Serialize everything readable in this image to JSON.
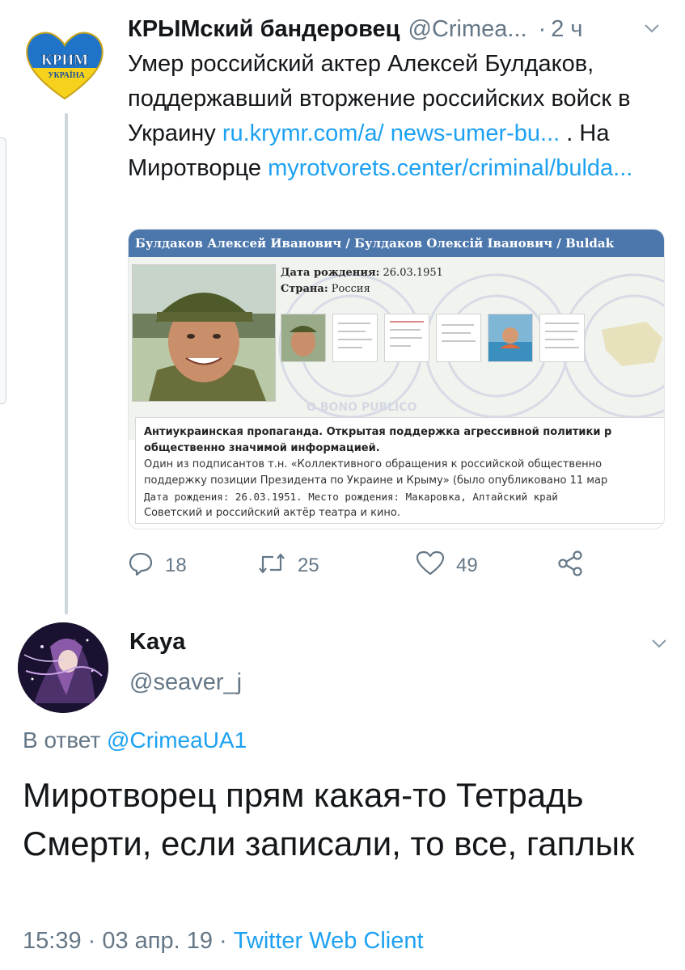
{
  "parent_tweet": {
    "author_name": "КРЫМский бандеровец",
    "handle": "@Crimea...",
    "dot": "·",
    "time": "2 ч",
    "avatar_text_top": "КРИМ",
    "avatar_text_bottom": "УКРАЇНА",
    "text_part1": "Умер российский актер Алексей Булдаков, поддержавший вторжение российских войск в Украину ",
    "link1": "ru.krymr.com/a/ news-umer-bu...",
    "text_part2": " . На Миротворце ",
    "link2": "myrotvorets.center/criminal/bulda...",
    "card": {
      "title": "Булдаков Алексей Иванович / Булдаков Олексій Іванович / Buldak",
      "dob_label": "Дата рождения:",
      "dob_value": "26.03.1951",
      "country_label": "Страна:",
      "country_value": "Россия",
      "watermark": "O BONO PUBLICO",
      "desc_heading_1": "Антиукраинская пропаганда. Открытая поддержка агрессивной политики р",
      "desc_heading_2": "общественно значимой информацией.",
      "desc_line_1": "Один из подписантов т.н. «Коллективного обращения к российской общественно",
      "desc_line_2": "поддержку позиции Президента по Украине и Крыму» (было опубликовано 11 мар",
      "desc_line_3": "Дата рождения:  26.03.1951. Место рождения:  Макаровка, Алтайский край",
      "desc_line_4": "Советский и российский актёр театра и кино."
    },
    "actions": {
      "replies": "18",
      "retweets": "25",
      "likes": "49"
    }
  },
  "reply_tweet": {
    "author_name": "Kaya",
    "handle": "@seaver_j",
    "reply_prefix": "В ответ",
    "reply_to": "@CrimeaUA1",
    "text": "Миротворец прям какая-то Тетрадь Смерти, если записали, то все, гаплык",
    "timestamp": "15:39 · 03 апр. 19 · ",
    "client": "Twitter Web Client"
  },
  "colors": {
    "link": "#1da1f2",
    "secondary_text": "#657786",
    "primary_text": "#14171a",
    "card_header": "#4c77ac",
    "thread_line": "#ccd6dd"
  },
  "icons": [
    "chevron-down-icon",
    "reply-icon",
    "retweet-icon",
    "like-icon",
    "share-icon"
  ]
}
